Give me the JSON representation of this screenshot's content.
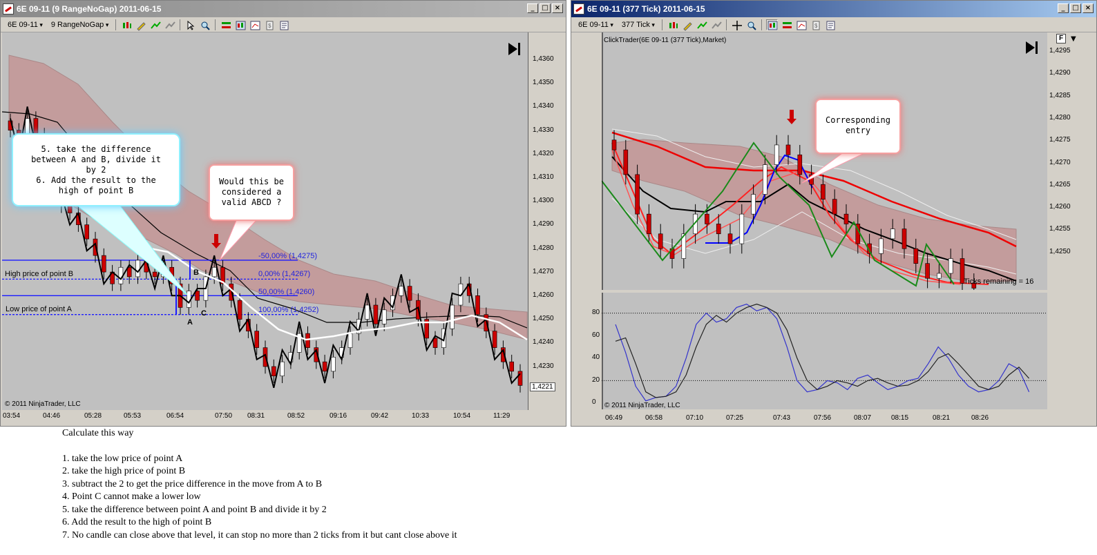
{
  "left_window": {
    "title": "6E 09-11 (9 RangeNoGap)  2011-06-15",
    "instrument": "6E 09-11",
    "period": "9 RangeNoGap",
    "y_ticks": [
      "1,4360",
      "1,4350",
      "1,4340",
      "1,4330",
      "1,4320",
      "1,4310",
      "1,4300",
      "1,4290",
      "1,4280",
      "1,4270",
      "1,4260",
      "1,4250",
      "1,4240",
      "1,4230"
    ],
    "x_ticks": [
      "03:54",
      "04:46",
      "05:28",
      "05:53",
      "06:54",
      "07:50",
      "08:31",
      "08:52",
      "09:16",
      "09:42",
      "10:33",
      "10:54",
      "11:29"
    ],
    "last_price": "1,4221",
    "copyright": "© 2011 NinjaTrader, LLC",
    "level_labels": [
      "-50,00% (1,4275)",
      "0,00% (1,4267)",
      "50,00% (1,4260)",
      "100,00% (1,4252)"
    ],
    "point_labels": {
      "a": "A",
      "b": "B",
      "c": "C"
    },
    "side_labels": {
      "high": "High price of point B",
      "low": "Low price of point A"
    },
    "callout_1": [
      "5. take the difference",
      "between A and B, divide it",
      "by 2",
      "6. Add the result to the",
      "high of point B"
    ],
    "callout_2": [
      "Would this be",
      "considered a",
      "valid ABCD ?"
    ]
  },
  "right_window": {
    "title": "6E 09-11 (377 Tick)  2011-06-15",
    "instrument": "6E 09-11",
    "period": "377 Tick",
    "chart_label": "ClickTrader(6E 09-11 (377 Tick),Market)",
    "y_ticks": [
      "1,4295",
      "1,4290",
      "1,4285",
      "1,4280",
      "1,4275",
      "1,4270",
      "1,4265",
      "1,4260",
      "1,4255",
      "1,4250"
    ],
    "osc_ticks": [
      "80",
      "60",
      "40",
      "20",
      "0"
    ],
    "x_ticks": [
      "06:49",
      "06:58",
      "07:10",
      "07:25",
      "07:43",
      "07:56",
      "08:07",
      "08:15",
      "08:21",
      "08:26"
    ],
    "ticks_remaining": "Ticks remaining = 16",
    "copyright": "© 2011 NinjaTrader, LLC",
    "f_button": "F",
    "callout_3": [
      "Corresponding",
      "entry"
    ]
  },
  "notes": {
    "heading": "Calculate this way",
    "items": [
      "1. take the low price of point A",
      "2. take the high price of point B",
      "3. subtract the 2 to get the price difference in the move from A to B",
      "4. Point C cannot make a lower low",
      "5. take the difference between point A and point B and divide it by 2",
      "6. Add the result to the high of point B",
      "7. No candle can close above that level, it can stop no more than 2 ticks from it but cant close above it"
    ]
  },
  "colors": {
    "up": "#ffffff",
    "down": "#cc0000",
    "cloud": "#c39c9c",
    "fib": "#1a1aff",
    "zigzag_left": "#000000",
    "zigzag_right": "#1a8a1a"
  }
}
